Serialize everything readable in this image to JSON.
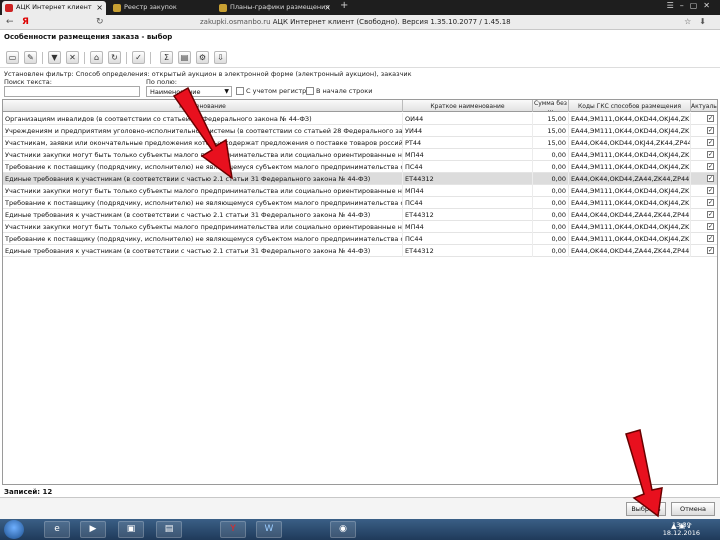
{
  "browser": {
    "tabs": [
      {
        "label": "АЦК Интернет клиент",
        "active": true
      },
      {
        "label": "Реестр закупок",
        "active": false
      },
      {
        "label": "Планы-графики размещения",
        "active": false
      }
    ],
    "back_icon": "arrow-left",
    "brand": "Я",
    "url_domain": "zakupki.osmanbo.ru",
    "page_title_in_bar": "АЦК Интернет клиент (Свободно). Версия 1.35.10.2077 / 1.45.18"
  },
  "app": {
    "title": "Особенности размещения заказа - выбор"
  },
  "filters": {
    "applied_filter_text": "Установлен фильтр: Способ определения: открытый аукцион в электронной форме (электронный аукцион), заказчик",
    "search_label": "Поиск текста:",
    "search_value": "",
    "field_label": "По полю:",
    "field_value": "Наименование",
    "case_label": "С учетом регистра",
    "whole_word_label": "В начале строки"
  },
  "grid": {
    "columns": [
      "Наименование",
      "Краткое наименование",
      "Сумма без ...",
      "Коды ГКС способов размещения",
      "Актуально"
    ],
    "rows": [
      {
        "name": "Организациям инвалидов (в соответствии со статьей 29 Федерального закона № 44-ФЗ)",
        "short": "ОИ44",
        "amount": "15,00",
        "codes": "EA44,ЭМ111,OK44,OKD44,OKJ44,ZK",
        "checked": true
      },
      {
        "name": "Учреждениям и предприятиям уголовно-исполнительной системы (в соответствии со статьей 28 Федерального закона № 44-ФЗ)",
        "short": "УИ44",
        "amount": "15,00",
        "codes": "EA44,ЭМ111,OK44,OKD44,OKJ44,ZK",
        "checked": true
      },
      {
        "name": "Участникам, заявки или окончательные предложения которых содержат предложения о поставке товаров российского происхождения",
        "short": "РТ44",
        "amount": "15,00",
        "codes": "EA44,OK44,OKD44,OKJ44,ZK44,ZP44",
        "checked": true
      },
      {
        "name": "Участники закупки могут быть только субъекты малого предпринимательства или социально ориентированные некоммерческие организации",
        "short": "МП44",
        "amount": "0,00",
        "codes": "EA44,ЭМ111,OK44,OKD44,OKJ44,ZK",
        "checked": true
      },
      {
        "name": "Требование к поставщику (подрядчику, исполнителю) не являющемуся субъектом малого предпринимательства о привлечении субподрядчиков",
        "short": "ПС44",
        "amount": "0,00",
        "codes": "EA44,ЭМ111,OK44,OKD44,OKJ44,ZK",
        "checked": true
      },
      {
        "name": "Единые требования к участникам (в соответствии с частью 2.1 статьи 31 Федерального закона № 44-ФЗ)",
        "short": "ЕТ44312",
        "amount": "0,00",
        "codes": "EA44,OK44,OKD44,ZA44,ZK44,ZP44",
        "checked": true,
        "selected": true
      },
      {
        "name": "Участники закупки могут быть только субъекты малого предпринимательства или социально ориентированные некоммерческие организации",
        "short": "МП44",
        "amount": "0,00",
        "codes": "EA44,ЭМ111,OK44,OKD44,OKJ44,ZK",
        "checked": true
      },
      {
        "name": "Требование к поставщику (подрядчику, исполнителю) не являющемуся субъектом малого предпринимательства о привлечении субподрядчиков",
        "short": "ПС44",
        "amount": "0,00",
        "codes": "EA44,ЭМ111,OK44,OKD44,OKJ44,ZK",
        "checked": true
      },
      {
        "name": "Единые требования к участникам (в соответствии с частью 2.1 статьи 31 Федерального закона № 44-ФЗ)",
        "short": "ЕТ44312",
        "amount": "0,00",
        "codes": "EA44,OK44,OKD44,ZA44,ZK44,ZP44",
        "checked": true
      },
      {
        "name": "Участники закупки могут быть только субъекты малого предпринимательства или социально ориентированные некоммерческие организации",
        "short": "МП44",
        "amount": "0,00",
        "codes": "EA44,ЭМ111,OK44,OKD44,OKJ44,ZK",
        "checked": true
      },
      {
        "name": "Требование к поставщику (подрядчику, исполнителю) не являющемуся субъектом малого предпринимательства о привлечении субподрядчиков",
        "short": "ПС44",
        "amount": "0,00",
        "codes": "EA44,ЭМ111,OK44,OKD44,OKJ44,ZK",
        "checked": true
      },
      {
        "name": "Единые требования к участникам (в соответствии с частью 2.1 статьи 31 Федерального закона № 44-ФЗ)",
        "short": "ЕТ44312",
        "amount": "0,00",
        "codes": "EA44,OK44,OKD44,ZA44,ZK44,ZP44",
        "checked": true
      }
    ]
  },
  "footer": {
    "records_label": "Записей: 12",
    "select_button": "Выбрать",
    "cancel_button": "Отмена"
  },
  "taskbar": {
    "time": "13:39",
    "date": "18.12.2016",
    "apps": [
      "explorer",
      "media",
      "folder",
      "files",
      "yandex",
      "word",
      "app"
    ]
  },
  "colors": {
    "selected_row": "#dcdcdc",
    "arrow": "#e8101e",
    "taskbar": "#2b4a6e"
  }
}
